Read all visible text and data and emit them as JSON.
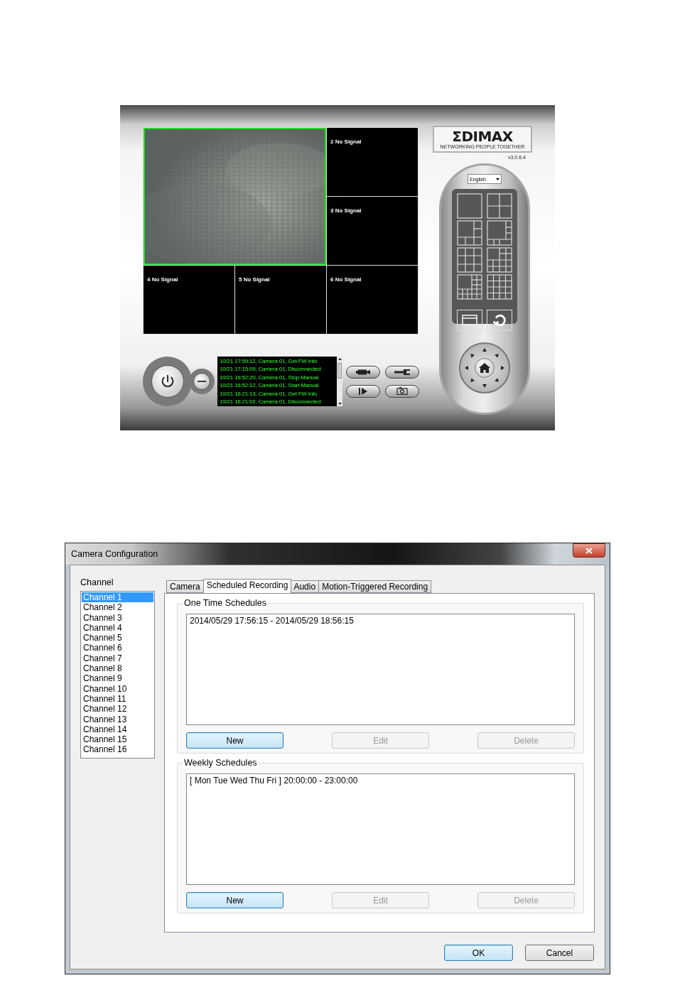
{
  "viewer": {
    "tiles": [
      {
        "kind": "video",
        "selected": true
      },
      {
        "kind": "no_signal",
        "label": "2 No Signal",
        "selected": false
      },
      {
        "kind": "no_signal",
        "label": "3 No Signal",
        "selected": false
      },
      {
        "kind": "no_signal",
        "label": "4 No Signal",
        "selected": false
      },
      {
        "kind": "no_signal",
        "label": "5 No Signal",
        "selected": false
      },
      {
        "kind": "no_signal",
        "label": "6 No Signal",
        "selected": false
      }
    ],
    "logo": {
      "brand": "ΣDIMAX",
      "tagline": "NETWORKING PEOPLE TOGETHER"
    },
    "version": "v3.0.6.4",
    "language": "English",
    "log": [
      "10/21 17:59:12, Camera 01, Get FW Info",
      "10/21 17:15:09, Camera 01, Disconnected",
      "10/21 16:52:20, Camera 01, Stop Manual",
      "10/21 16:52:12, Camera 01, Start Manual",
      "10/21 16:21:13, Camera 01, Get FW Info",
      "10/21 16:21:02, Camera 01, Disconnected"
    ]
  },
  "dialog": {
    "title": "Camera Configuration",
    "channel_label": "Channel",
    "channels": [
      {
        "label": "Channel 1",
        "selected": true
      },
      {
        "label": "Channel 2",
        "selected": false
      },
      {
        "label": "Channel 3",
        "selected": false
      },
      {
        "label": "Channel 4",
        "selected": false
      },
      {
        "label": "Channel 5",
        "selected": false
      },
      {
        "label": "Channel 6",
        "selected": false
      },
      {
        "label": "Channel 7",
        "selected": false
      },
      {
        "label": "Channel 8",
        "selected": false
      },
      {
        "label": "Channel 9",
        "selected": false
      },
      {
        "label": "Channel 10",
        "selected": false
      },
      {
        "label": "Channel 11",
        "selected": false
      },
      {
        "label": "Channel 12",
        "selected": false
      },
      {
        "label": "Channel 13",
        "selected": false
      },
      {
        "label": "Channel 14",
        "selected": false
      },
      {
        "label": "Channel 15",
        "selected": false
      },
      {
        "label": "Channel 16",
        "selected": false
      }
    ],
    "tabs": [
      {
        "label": "Camera",
        "selected": false
      },
      {
        "label": "Scheduled Recording",
        "selected": true
      },
      {
        "label": "Audio",
        "selected": false
      },
      {
        "label": "Motion-Triggered Recording",
        "selected": false
      }
    ],
    "groups": [
      {
        "title": "One Time Schedules",
        "items": [
          "2014/05/29 17:56:15 - 2014/05/29 18:56:15"
        ],
        "buttons": [
          {
            "label": "New",
            "highlighted": true,
            "disabled": false
          },
          {
            "label": "Edit",
            "highlighted": false,
            "disabled": true
          },
          {
            "label": "Delete",
            "highlighted": false,
            "disabled": true
          }
        ]
      },
      {
        "title": "Weekly Schedules",
        "items": [
          "[ Mon Tue Wed Thu Fri ] 20:00:00 - 23:00:00"
        ],
        "buttons": [
          {
            "label": "New",
            "highlighted": true,
            "disabled": false
          },
          {
            "label": "Edit",
            "highlighted": false,
            "disabled": true
          },
          {
            "label": "Delete",
            "highlighted": false,
            "disabled": true
          }
        ]
      }
    ],
    "buttons": [
      {
        "label": "OK",
        "highlighted": true
      },
      {
        "label": "Cancel",
        "highlighted": false
      }
    ]
  }
}
